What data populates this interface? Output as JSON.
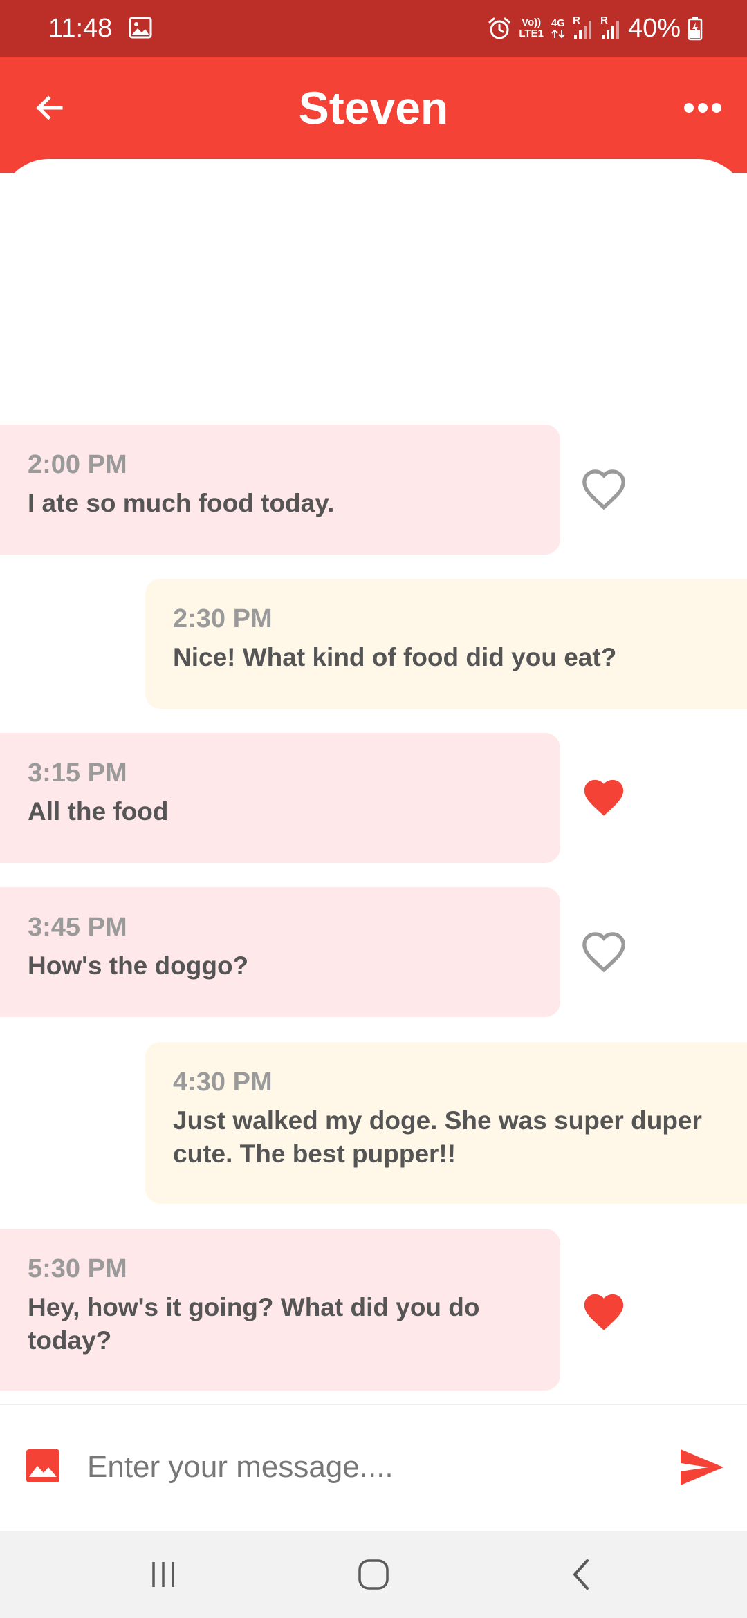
{
  "status_bar": {
    "time": "11:48",
    "volte_label_top": "Vo))",
    "volte_label_bottom": "LTE1",
    "network_label": "4G",
    "roaming_label_1": "R",
    "roaming_label_2": "R",
    "battery": "40%"
  },
  "app_bar": {
    "title": "Steven",
    "back_icon": "arrow-back-icon",
    "more_icon": "more-horizontal-icon"
  },
  "messages": [
    {
      "direction": "incoming",
      "time": "2:00 PM",
      "text": "I ate so much food today.",
      "liked": false
    },
    {
      "direction": "outgoing",
      "time": "2:30 PM",
      "text": "Nice! What kind of food did you eat?"
    },
    {
      "direction": "incoming",
      "time": "3:15 PM",
      "text": "All the food",
      "liked": true
    },
    {
      "direction": "incoming",
      "time": "3:45 PM",
      "text": "How's the doggo?",
      "liked": false
    },
    {
      "direction": "outgoing",
      "time": "4:30 PM",
      "text": "Just walked my doge. She was super duper cute. The best pupper!!"
    },
    {
      "direction": "incoming",
      "time": "5:30 PM",
      "text": "Hey, how's it going? What did you do today?",
      "liked": true
    }
  ],
  "composer": {
    "placeholder": "Enter your message....",
    "value": "",
    "image_icon": "image-icon",
    "send_icon": "send-icon"
  },
  "nav_bar": {
    "recents_icon": "recent-apps-icon",
    "home_icon": "home-icon",
    "back_icon": "nav-back-icon"
  },
  "colors": {
    "status_bar": "#bb2f28",
    "app_bar": "#f44336",
    "incoming_bubble": "#ffe8ea",
    "outgoing_bubble": "#fff8e9",
    "accent": "#f44336",
    "heart_outline": "#9a9a9a"
  }
}
